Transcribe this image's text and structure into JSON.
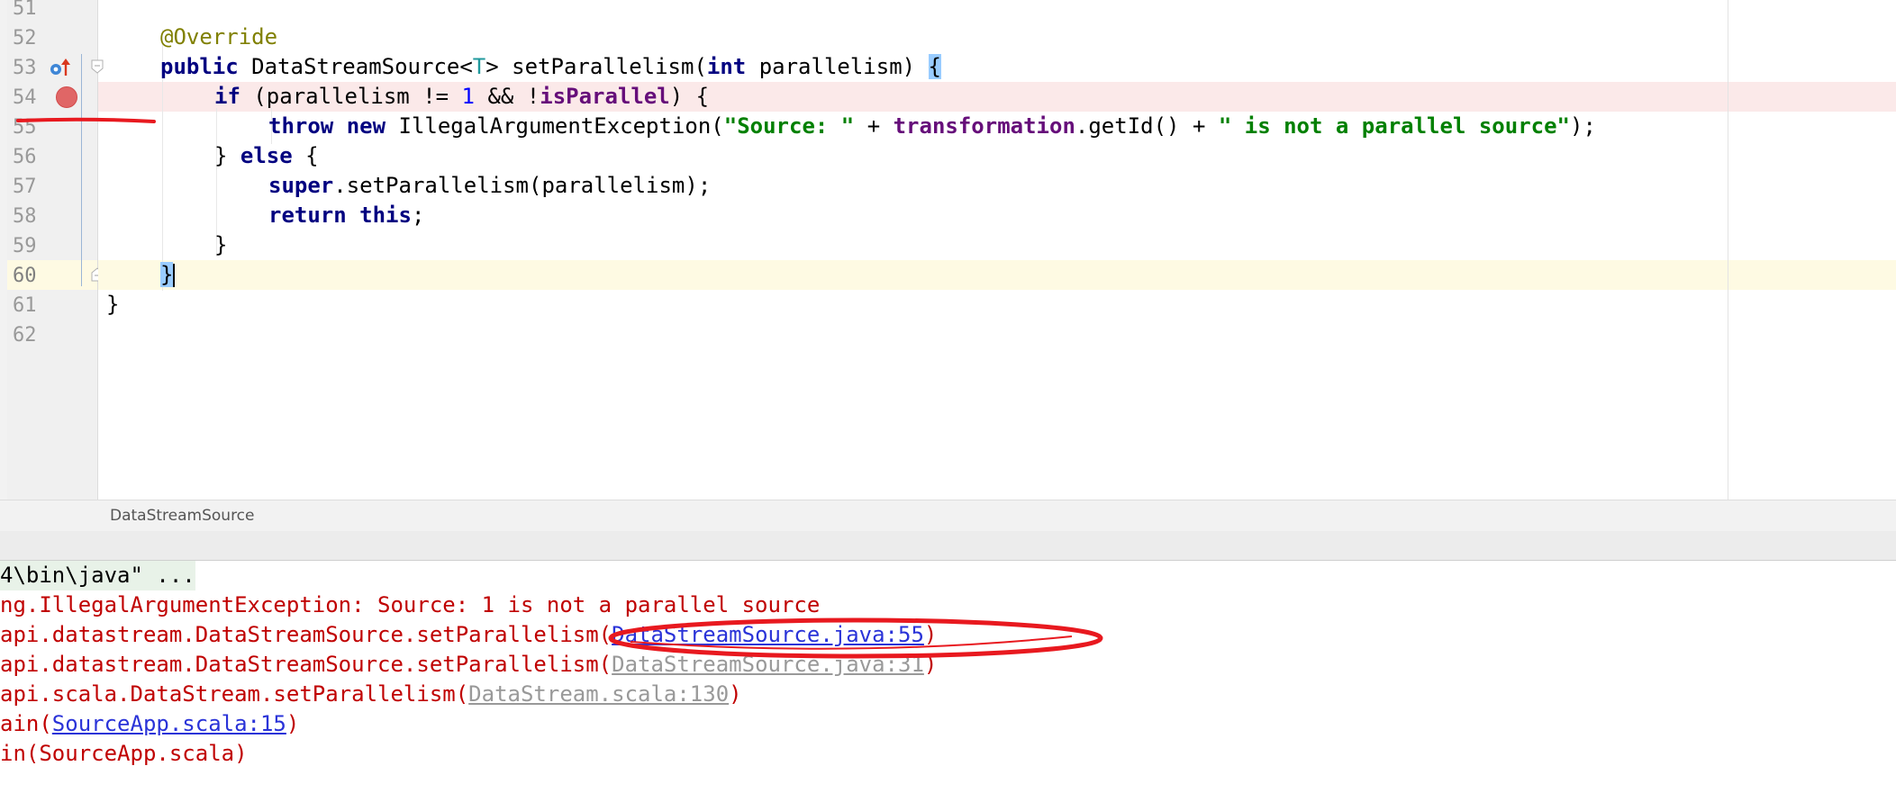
{
  "editor": {
    "line_numbers": [
      "51",
      "52",
      "53",
      "54",
      "55",
      "56",
      "57",
      "58",
      "59",
      "60",
      "61",
      "62"
    ],
    "code": {
      "l52": {
        "annotation": "@Override"
      },
      "l53": {
        "kw_public": "public",
        "type_start": "DataStreamSource<",
        "type_param": "T",
        "type_end": "> setParallelism(",
        "kw_int": "int",
        "param": " parallelism) ",
        "brace": "{"
      },
      "l54": {
        "kw_if": "if",
        "a": " (parallelism != ",
        "num": "1",
        "b": " && !",
        "field": "isParallel",
        "c": ") {"
      },
      "l55": {
        "kw_throw": "throw",
        "kw_new": "new",
        "a": " IllegalArgumentException(",
        "str1": "\"Source: \"",
        "b": " + ",
        "field": "transformation",
        "c": ".getId() + ",
        "str2": "\" is not a parallel source\"",
        "d": ");"
      },
      "l56": {
        "a": "} ",
        "kw_else": "else",
        "b": " {"
      },
      "l57": {
        "kw_super": "super",
        "a": ".setParallelism(parallelism);"
      },
      "l58": {
        "kw_return": "return",
        "kw_this": "this",
        "a": ";"
      },
      "l59": {
        "a": "}"
      },
      "l60": {
        "brace": "}"
      },
      "l61": {
        "a": "}"
      }
    }
  },
  "breadcrumb": {
    "label": "DataStreamSource"
  },
  "console": {
    "line1": "4\\bin\\java\" ...",
    "line2": "ng.IllegalArgumentException: Source: 1 is not a parallel source",
    "line3_prefix": "api.datastream.DataStreamSource.setParallelism(",
    "line3_link": "DataStreamSource.java:55",
    "line3_suffix": ")",
    "line4_prefix": "api.datastream.DataStreamSource.setParallelism(",
    "line4_link": "DataStreamSource.java:31",
    "line4_suffix": ")",
    "line5_prefix": "api.scala.DataStream.setParallelism(",
    "line5_link": "DataStream.scala:130",
    "line5_suffix": ")",
    "line6_prefix": "ain(",
    "line6_link": "SourceApp.scala:15",
    "line6_suffix": ")",
    "line7": "in(SourceApp.scala)"
  },
  "colors": {
    "breakpoint": "#e06666",
    "annotation_markup": "#e8191f",
    "link": "#2a33d8"
  },
  "icons": [
    "override-marker-icon",
    "breakpoint-icon",
    "fold-icon"
  ]
}
